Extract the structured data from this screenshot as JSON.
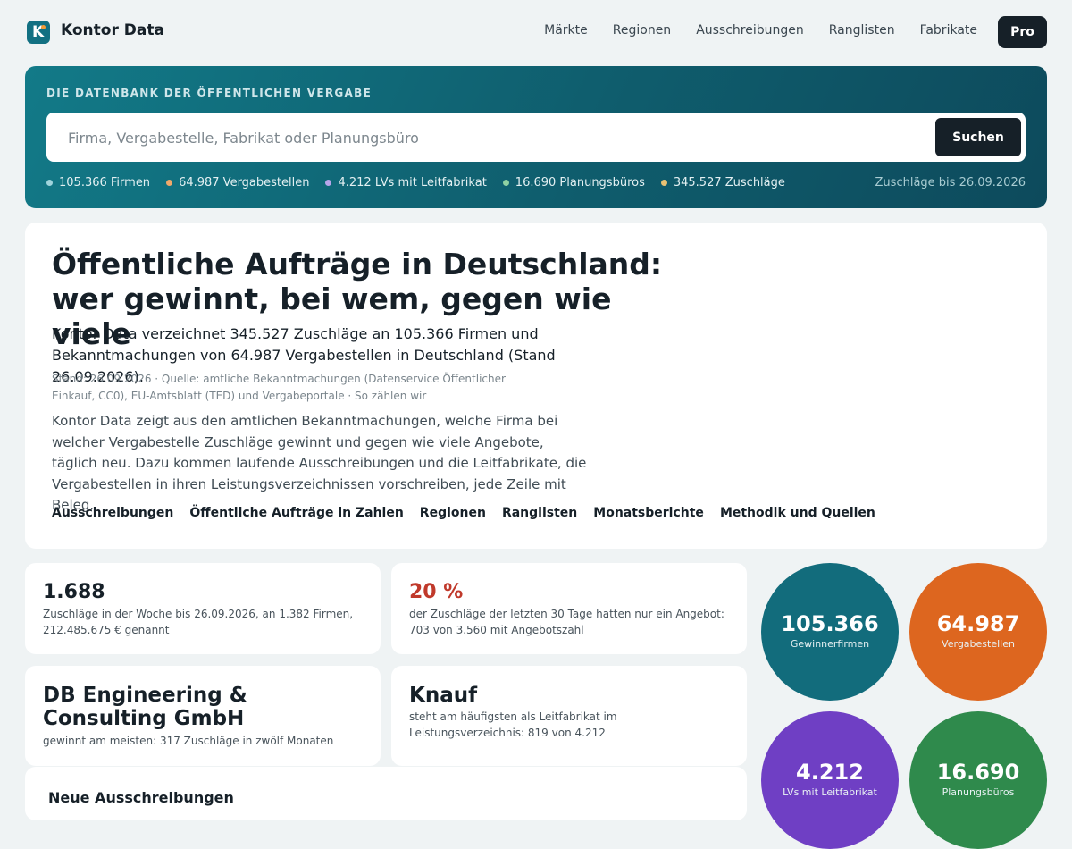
{
  "nav": {
    "brand": "Kontor Data",
    "logo_letter": "K",
    "links": [
      "Märkte",
      "Regionen",
      "Ausschreibungen",
      "Ranglisten",
      "Fabrikate"
    ],
    "pro_label": "Pro"
  },
  "hero": {
    "label": "DIE DATENBANK DER ÖFFENTLICHEN VERGABE",
    "search_placeholder": "Firma, Vergabestelle, Fabrikat oder Planungsbüro",
    "search_button": "Suchen",
    "stats": [
      {
        "text": "105.366 Firmen",
        "color": "#9fd4dc"
      },
      {
        "text": "64.987 Vergabestellen",
        "color": "#f0a86a"
      },
      {
        "text": "4.212 LVs mit Leitfabrikat",
        "color": "#b8a5ea"
      },
      {
        "text": "16.690 Planungsbüros",
        "color": "#8fd1a3"
      },
      {
        "text": "345.527 Zuschläge",
        "color": "#e8c173"
      }
    ],
    "updated": "Zuschläge bis 26.09.2026"
  },
  "intro": {
    "title_line1": "Öffentliche Aufträge in Deutschland:",
    "title_line2": "wer gewinnt, bei wem, gegen wie viele",
    "lead": "Kontor Data verzeichnet 345.527 Zuschläge an 105.366 Firmen und Bekanntmachungen von 64.987 Vergabestellen in Deutschland (Stand 26.09.2026).",
    "meta": "Stand: 26.09.2026 · Quelle: amtliche Bekanntmachungen (Datenservice Öffentlicher Einkauf, CC0), EU-Amtsblatt (TED) und Vergabeportale · So zählen wir",
    "body": "Kontor Data zeigt aus den amtlichen Bekanntmachungen, welche Firma bei welcher Vergabestelle Zuschläge gewinnt und gegen wie viele Angebote, täglich neu. Dazu kommen laufende Ausschreibungen und die Leitfabrikate, die Vergabestellen in ihren Leistungsverzeichnissen vorschreiben, jede Zeile mit Beleg.",
    "links": [
      "Ausschreibungen",
      "Öffentliche Aufträge in Zahlen",
      "Regionen",
      "Ranglisten",
      "Monatsberichte",
      "Methodik und Quellen"
    ]
  },
  "cards": {
    "weekly": {
      "value": "1.688",
      "text": "Zuschläge in der Woche bis 26.09.2026, an 1.382 Firmen, 212.485.675 € genannt"
    },
    "single_bid": {
      "value": "20 %",
      "text": "der Zuschläge der letzten 30 Tage hatten nur ein Angebot: 703 von 3.560 mit Angebotszahl"
    },
    "top_winner": {
      "name": "DB Engineering & Consulting GmbH",
      "text": "gewinnt am meisten: 317 Zuschläge in zwölf Monaten"
    },
    "top_brand": {
      "name": "Knauf",
      "text": "steht am häufigsten als Leitfabrikat im Leistungsverzeichnis: 819 von 4.212"
    },
    "tenders": {
      "title": "Neue Ausschreibungen"
    }
  },
  "circles": [
    {
      "value": "105.366",
      "label": "Gewinnerfirmen",
      "color": "#126c7c"
    },
    {
      "value": "64.987",
      "label": "Vergabestellen",
      "color": "#dd661f"
    },
    {
      "value": "4.212",
      "label": "LVs mit Leitfabrikat",
      "color": "#6f3fc4"
    },
    {
      "value": "16.690",
      "label": "Planungsbüros",
      "color": "#2f8a4c"
    }
  ]
}
